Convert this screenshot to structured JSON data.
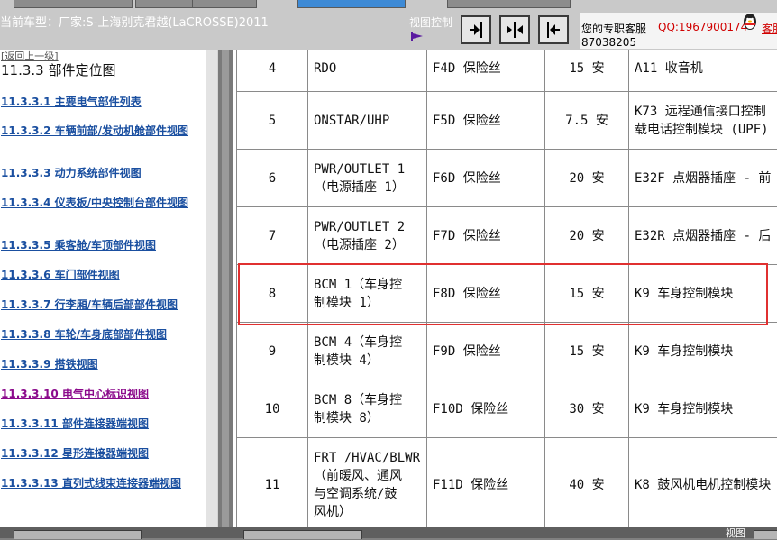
{
  "header": {
    "vehicle_label": "当前车型：厂家:S-上海别克君越(LaCROSSE)2011",
    "view_control_label": "视图控制",
    "support_label": "您的专职客服",
    "qq_label": "QQ:1967900174",
    "qq_number_line2": "87038205",
    "kefu_label": "客服"
  },
  "nav": {
    "back_link": "[返回上一级]",
    "title": "11.3.3 部件定位图",
    "items": [
      "11.3.3.1 主要电气部件列表",
      "11.3.3.2 车辆前部/发动机舱部件视图",
      "11.3.3.3 动力系统部件视图",
      "11.3.3.4 仪表板/中央控制台部件视图",
      "11.3.3.5 乘客舱/车顶部件视图",
      "11.3.3.6 车门部件视图",
      "11.3.3.7 行李厢/车辆后部部件视图",
      "11.3.3.8 车轮/车身底部部件视图",
      "11.3.3.9 搭铁视图",
      "11.3.3.10 电气中心标识视图",
      "11.3.3.11 部件连接器端视图",
      "11.3.3.12 星形连接器端视图",
      "11.3.3.13 直列式线束连接器端视图"
    ],
    "active_index": 9
  },
  "table": {
    "rows": [
      {
        "num": "4",
        "name": "RDO",
        "fuse": "F4D 保险丝",
        "amp": "15 安",
        "desc": "A11 收音机"
      },
      {
        "num": "5",
        "name": "ONSTAR/UHP",
        "fuse": "F5D 保险丝",
        "amp": "7.5 安",
        "desc": "K73 远程通信接口控制\n载电话控制模块 (UPF)"
      },
      {
        "num": "6",
        "name": "PWR/OUTLET 1\n（电源插座 1）",
        "fuse": "F6D 保险丝",
        "amp": "20 安",
        "desc": "E32F 点烟器插座 - 前"
      },
      {
        "num": "7",
        "name": "PWR/OUTLET 2\n（电源插座 2）",
        "fuse": "F7D 保险丝",
        "amp": "20 安",
        "desc": "E32R 点烟器插座 - 后"
      },
      {
        "num": "8",
        "name": "BCM 1（车身控\n制模块 1）",
        "fuse": "F8D 保险丝",
        "amp": "15 安",
        "desc": "K9 车身控制模块"
      },
      {
        "num": "9",
        "name": "BCM 4（车身控\n制模块 4）",
        "fuse": "F9D 保险丝",
        "amp": "15 安",
        "desc": "K9 车身控制模块"
      },
      {
        "num": "10",
        "name": "BCM 8（车身控\n制模块 8）",
        "fuse": "F10D 保险丝",
        "amp": "30 安",
        "desc": "K9 车身控制模块"
      },
      {
        "num": "11",
        "name": "FRT /HVAC/BLWR\n（前暖风、通风\n与空调系统/鼓\n风机）",
        "fuse": "F11D 保险丝",
        "amp": "40 安",
        "desc": "K8 鼓风机电机控制模块"
      }
    ],
    "highlighted_row_index": 4
  },
  "footer": {
    "view_label": "视图"
  },
  "colors": {
    "highlight": "#e03030",
    "nav_link": "#1a4fa0",
    "nav_visited": "#8b0a8b",
    "qq_red": "#d00000"
  }
}
